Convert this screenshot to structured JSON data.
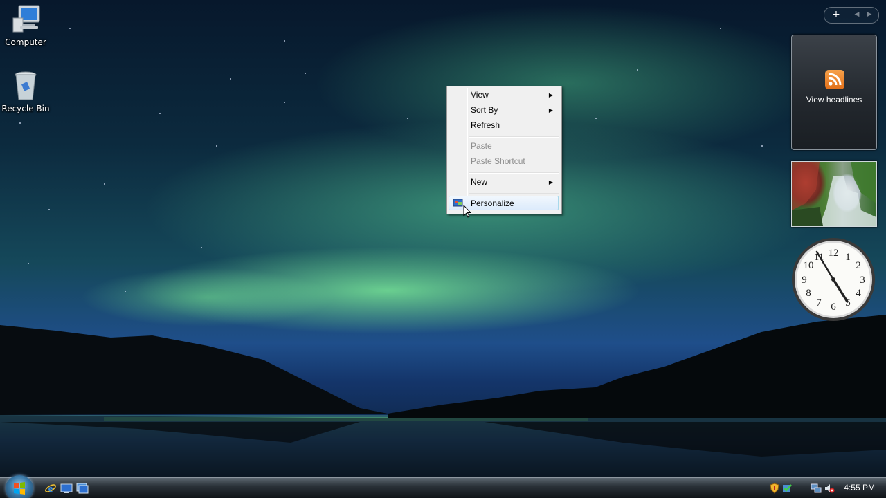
{
  "desktop": {
    "icons": [
      {
        "label": "Computer",
        "icon": "computer-icon"
      },
      {
        "label": "Recycle Bin",
        "icon": "recycle-bin-icon"
      }
    ]
  },
  "context_menu": {
    "items": [
      {
        "label": "View",
        "submenu": true,
        "enabled": true
      },
      {
        "label": "Sort By",
        "submenu": true,
        "enabled": true
      },
      {
        "label": "Refresh",
        "submenu": false,
        "enabled": true
      },
      {
        "label": "Paste",
        "submenu": false,
        "enabled": false
      },
      {
        "label": "Paste Shortcut",
        "submenu": false,
        "enabled": false
      },
      {
        "label": "New",
        "submenu": true,
        "enabled": true
      },
      {
        "label": "Personalize",
        "submenu": false,
        "enabled": true,
        "highlighted": true,
        "icon": "personalize-icon"
      }
    ]
  },
  "sidebar": {
    "toolbar": {
      "add_label": "+",
      "prev_label": "◀",
      "next_label": "▶"
    },
    "feed_gadget": {
      "label": "View headlines",
      "icon": "rss-icon"
    },
    "clock_gadget": {
      "time": "4:55",
      "numerals": [
        "12",
        "1",
        "2",
        "3",
        "4",
        "5",
        "6",
        "7",
        "8",
        "9",
        "10",
        "11"
      ]
    }
  },
  "taskbar": {
    "start_icon": "windows-logo-icon",
    "quick_launch": [
      "internet-explorer-icon",
      "show-desktop-icon",
      "switch-windows-icon"
    ],
    "tray_icons": [
      "security-shield-icon",
      "windows-update-icon",
      "network-icon",
      "volume-muted-icon"
    ],
    "clock": "4:55 PM"
  },
  "colors": {
    "menu_bg": "#f0f0f0",
    "menu_highlight": "#dcebfc",
    "disabled_text": "#8d8d8d",
    "rss_orange": "#f08a2c"
  }
}
